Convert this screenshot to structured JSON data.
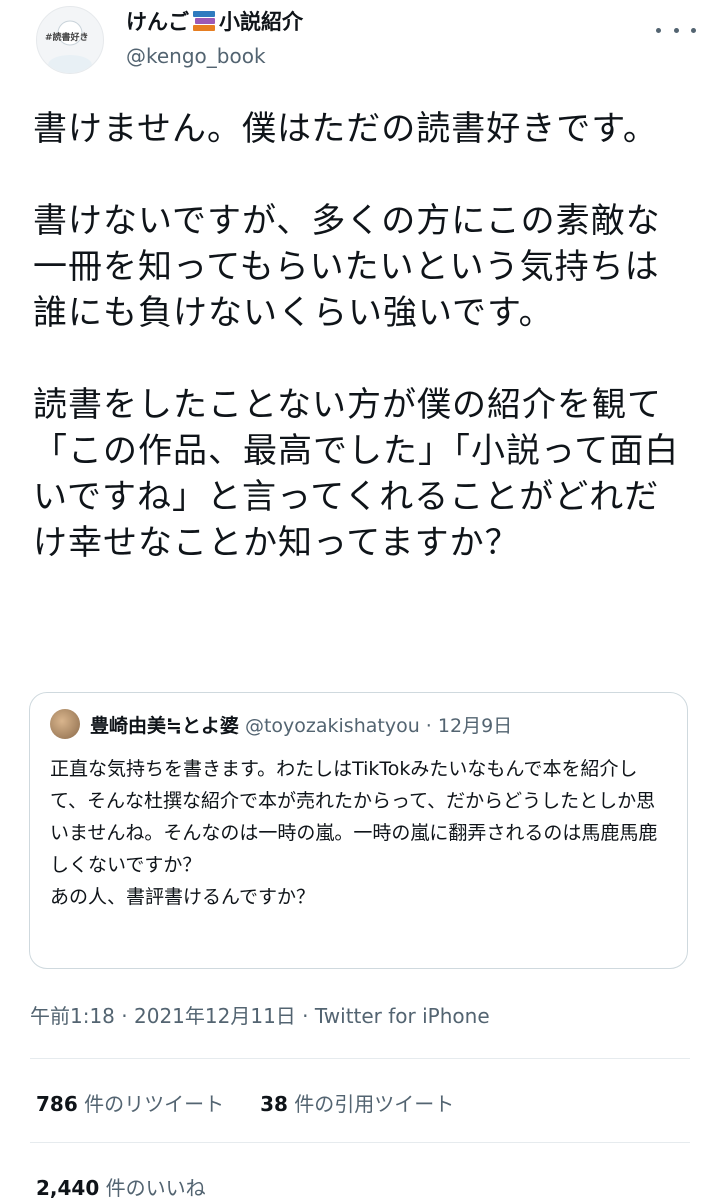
{
  "author": {
    "display_name": "けんご",
    "display_name_suffix": "小説紹介",
    "name_emoji": "books-icon",
    "handle": "@kengo_book",
    "avatar_tag": "#読書好き"
  },
  "more_icon": "more-horizontal-icon",
  "tweet_text": "書けません。僕はただの読書好きです。\n\n書けないですが、多くの方にこの素敵な一冊を知ってもらいたいという気持ちは誰にも負けないくらい強いです。\n\n読書をしたことない方が僕の紹介を観て「この作品、最高でした」「小説って面白いですね」と言ってくれることがどれだけ幸せなことか知ってますか？",
  "quoted": {
    "display_name": "豊崎由美≒とよ婆",
    "handle": "@toyozakishatyou",
    "separator": " · ",
    "date": "12月9日",
    "text": "正直な気持ちを書きます。わたしはTikTokみたいなもんで本を紹介して、そんな杜撰な紹介で本が売れたからって、だからどうしたとしか思いませんね。そんなのは一時の嵐。一時の嵐に翻弄されるのは馬鹿馬鹿しくないですか？\nあの人、書評書けるんですか？"
  },
  "meta": {
    "time": "午前1:18",
    "sep1": " · ",
    "date": "2021年12月11日",
    "sep2": " · ",
    "client": "Twitter for iPhone"
  },
  "stats": {
    "retweets_count": "786",
    "retweets_label": " 件のリツイート",
    "quotes_count": "38",
    "quotes_label": " 件の引用ツイート",
    "likes_count": "2,440",
    "likes_label": " 件のいいね"
  },
  "colors": {
    "text": "#0f1419",
    "secondary": "#536471",
    "border": "#cfd9de"
  }
}
